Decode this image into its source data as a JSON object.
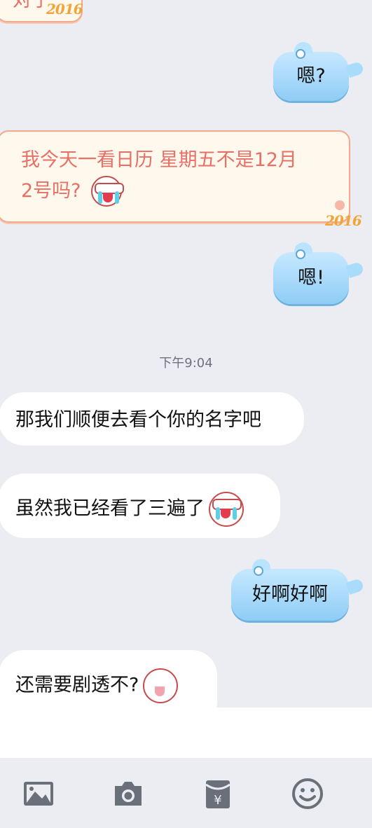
{
  "messages": [
    {
      "id": "m0",
      "side": "left",
      "style": "holiday",
      "text": "对子"
    },
    {
      "id": "m1",
      "side": "right",
      "style": "whale",
      "text": "嗯?"
    },
    {
      "id": "m2",
      "side": "left",
      "style": "holiday",
      "line1": "我今天一看日历  星期五不是12月",
      "line2": "2号吗?"
    },
    {
      "id": "m3",
      "side": "right",
      "style": "whale",
      "text": "嗯!"
    },
    {
      "id": "m4",
      "side": "left",
      "style": "plain",
      "text": "那我们顺便去看个你的名字吧"
    },
    {
      "id": "m5",
      "side": "left",
      "style": "plain",
      "text": "虽然我已经看了三遍了"
    },
    {
      "id": "m6",
      "side": "right",
      "style": "whale",
      "text": "好啊好啊"
    },
    {
      "id": "m7",
      "side": "left",
      "style": "plain",
      "text": "还需要剧透不?"
    }
  ],
  "decorations": {
    "year_mark": "2016"
  },
  "timestamp": "下午9:04",
  "toolbar": {
    "items": [
      {
        "name": "image-icon"
      },
      {
        "name": "camera-icon"
      },
      {
        "name": "red-packet-icon",
        "symbol": "¥"
      },
      {
        "name": "emoji-icon"
      }
    ],
    "icon_color": "#6a7079"
  },
  "colors": {
    "background": "#ebedf2",
    "whale_bubble": "#9fd6fa",
    "holiday_text": "#e86f66",
    "holiday_border": "#f3a98e"
  }
}
